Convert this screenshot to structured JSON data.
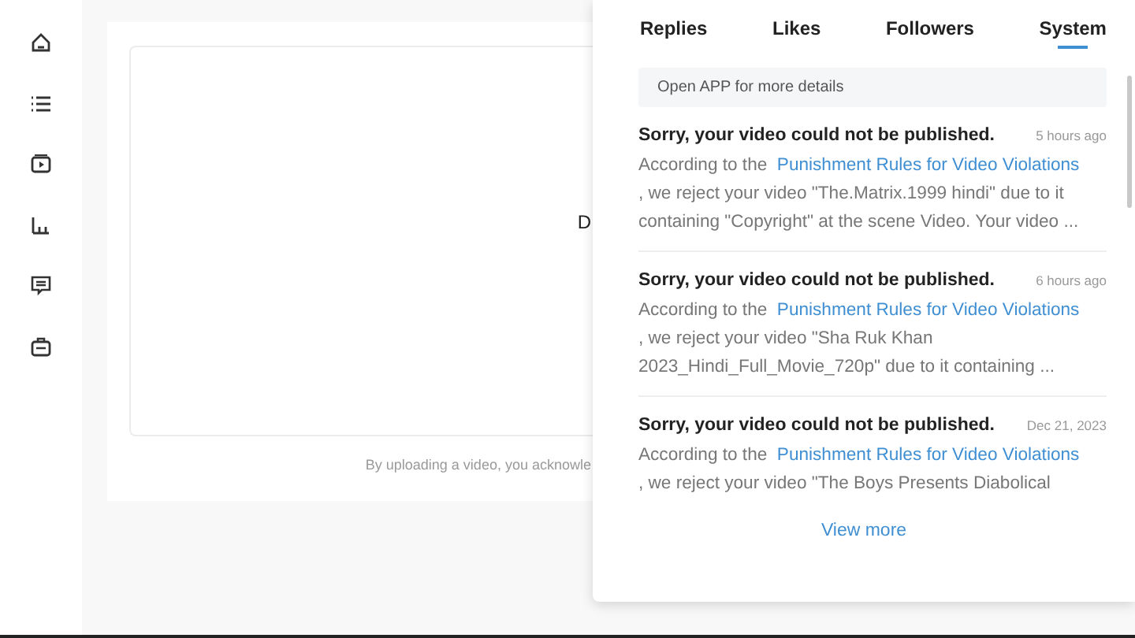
{
  "sidebar": {
    "items": [
      {
        "kind": "home"
      },
      {
        "kind": "list"
      },
      {
        "kind": "video"
      },
      {
        "kind": "chart"
      },
      {
        "kind": "chat"
      },
      {
        "kind": "case"
      }
    ]
  },
  "upload": {
    "drop_text": "D",
    "notice": "By uploading a video, you acknowle"
  },
  "notifications": {
    "tabs": [
      {
        "label": "Replies",
        "selected": false
      },
      {
        "label": "Likes",
        "selected": false
      },
      {
        "label": "Followers",
        "selected": false
      },
      {
        "label": "System",
        "selected": true
      }
    ],
    "banner": "Open APP for more details",
    "messages": [
      {
        "title": "Sorry, your video could not be published.",
        "time": "5 hours ago",
        "prefix": "According to the",
        "link": "Punishment Rules for Video Violations",
        "text": ", we reject your video \"The.Matrix.1999 hindi\" due to it containing \"Copyright\" at the scene Video. Your video ..."
      },
      {
        "title": "Sorry, your video could not be published.",
        "time": "6 hours ago",
        "prefix": "According to the",
        "link": "Punishment Rules for Video Violations",
        "text": ", we reject your video \"Sha Ruk Khan 2023_Hindi_Full_Movie_720p\" due to it containing ..."
      },
      {
        "title": "Sorry, your video could not be published.",
        "time": "Dec 21, 2023",
        "prefix": "According to the",
        "link": "Punishment Rules for Video Violations",
        "text": ", we reject your video \"The Boys Presents Diabolical"
      }
    ],
    "more": "View more"
  }
}
